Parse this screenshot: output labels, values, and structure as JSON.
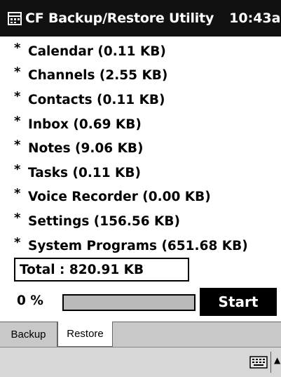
{
  "window": {
    "title": "CF Backup/Restore Utility",
    "clock": "10:43a"
  },
  "items": [
    {
      "label": "Calendar (0.11 KB)"
    },
    {
      "label": "Channels (2.55 KB)"
    },
    {
      "label": "Contacts (0.11 KB)"
    },
    {
      "label": "Inbox (0.69 KB)"
    },
    {
      "label": "Notes (9.06 KB)"
    },
    {
      "label": "Tasks (0.11 KB)"
    },
    {
      "label": "Voice Recorder (0.00 KB)"
    },
    {
      "label": "Settings (156.56 KB)"
    },
    {
      "label": "System Programs (651.68 KB)"
    }
  ],
  "total": "Total : 820.91 KB",
  "progress": {
    "percent_text": "0 %",
    "value": 0
  },
  "start_label": "Start",
  "tabs": {
    "backup": "Backup",
    "restore": "Restore",
    "active": "restore"
  },
  "icons": {
    "app": "app-icon",
    "keyboard": "keyboard-icon",
    "sip_arrow": "up-arrow-icon"
  },
  "colors": {
    "titlebar": "#111111",
    "progress_track": "#b9b9b9",
    "tabbar": "#c8c8c8",
    "start_button": "#000000"
  }
}
